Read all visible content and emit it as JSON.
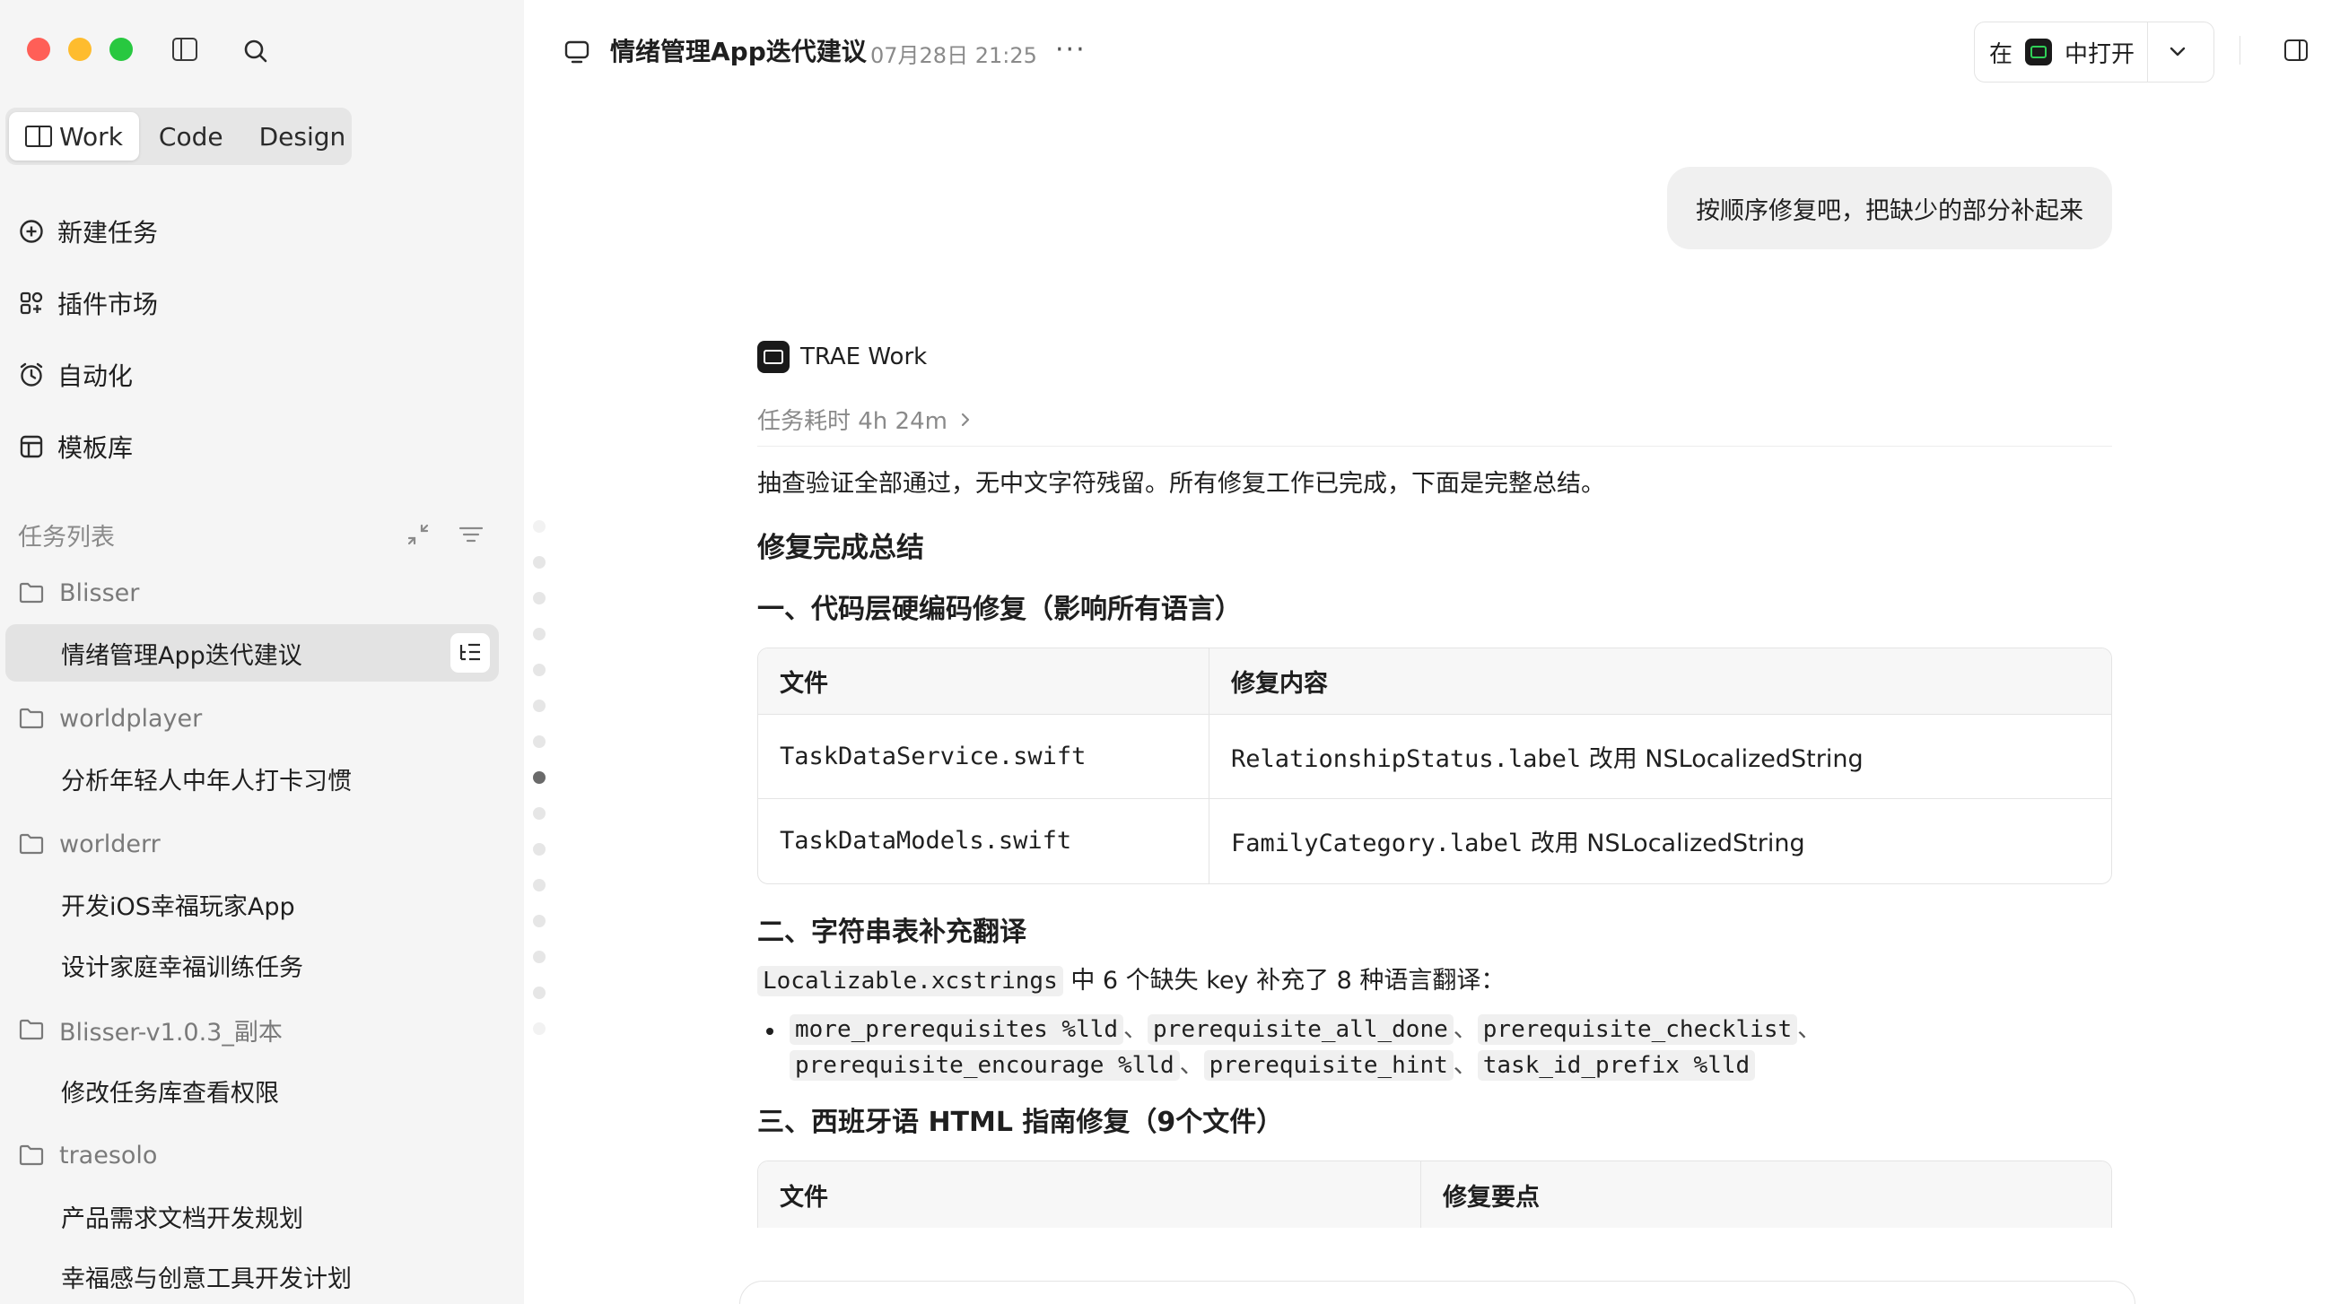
{
  "sidebar": {
    "modes": [
      "Work",
      "Code",
      "Design"
    ],
    "nav": {
      "new_task": "新建任务",
      "plugins": "插件市场",
      "automation": "自动化",
      "templates": "模板库"
    },
    "tasks_title": "任务列表",
    "groups": [
      {
        "folder": "Blisser",
        "tasks": [
          "情绪管理App迭代建议"
        ]
      },
      {
        "folder": "worldplayer",
        "tasks": [
          "分析年轻人中年人打卡习惯"
        ]
      },
      {
        "folder": "worlderr",
        "tasks": [
          "开发iOS幸福玩家App",
          "设计家庭幸福训练任务"
        ]
      },
      {
        "folder": "Blisser-v1.0.3_副本",
        "tasks": [
          "修改任务库查看权限"
        ]
      },
      {
        "folder": "traesolo",
        "tasks": [
          "产品需求文档开发规划",
          "幸福感与创意工具开发计划"
        ]
      }
    ]
  },
  "header": {
    "title": "情绪管理App迭代建议",
    "time": "07月28日 21:25",
    "more": "···",
    "open_prefix": "在",
    "open_label": "中打开"
  },
  "user_message": "按顺序修复吧，把缺少的部分补起来",
  "agent": {
    "name": "TRAE Work",
    "duration": "任务耗时 4h 24m",
    "intro": "抽查验证全部通过，无中文字符残留。所有修复工作已完成，下面是完整总结。",
    "summary_title": "修复完成总结",
    "section1_title": "一、代码层硬编码修复（影响所有语言）",
    "table1": {
      "headers": [
        "文件",
        "修复内容"
      ],
      "rows": [
        {
          "file": "TaskDataService.swift",
          "code": "RelationshipStatus.label",
          "text": " 改用 NSLocalizedString"
        },
        {
          "file": "TaskDataModels.swift",
          "code": "FamilyCategory.label",
          "text": " 改用 NSLocalizedString"
        }
      ]
    },
    "section2_title": "二、字符串表补充翻译",
    "section2_file": "Localizable.xcstrings",
    "section2_text": " 中 6 个缺失 key 补充了 8 种语言翻译：",
    "keys": [
      "more_prerequisites %lld",
      "prerequisite_all_done",
      "prerequisite_checklist",
      "prerequisite_encourage %lld",
      "prerequisite_hint",
      "task_id_prefix %lld"
    ],
    "key_separator": "、",
    "section3_title": "三、西班牙语 HTML 指南修复（9个文件）",
    "table2_headers": [
      "文件",
      "修复要点"
    ]
  }
}
